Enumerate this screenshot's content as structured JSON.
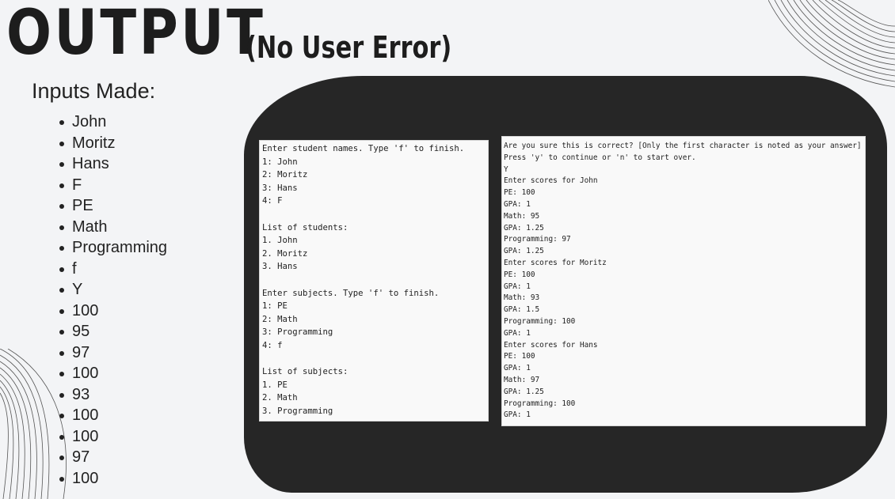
{
  "title": {
    "main": "OUTPUT",
    "sub": "(No User Error)"
  },
  "inputs": {
    "heading": "Inputs Made:",
    "items": [
      "John",
      "Moritz",
      "Hans",
      "F",
      "PE",
      "Math",
      "Programming",
      "f",
      "Y",
      "100",
      "95",
      "97",
      "100",
      "93",
      "100",
      "100",
      "97",
      "100"
    ]
  },
  "console_left": {
    "lines": [
      "Enter student names. Type 'f' to finish.",
      "1: John",
      "2: Moritz",
      "3: Hans",
      "4: F",
      "",
      "List of students:",
      "1. John",
      "2. Moritz",
      "3. Hans",
      "",
      "Enter subjects. Type 'f' to finish.",
      "1: PE",
      "2: Math",
      "3: Programming",
      "4: f",
      "",
      "List of subjects:",
      "1. PE",
      "2. Math",
      "3. Programming"
    ]
  },
  "console_right": {
    "lines": [
      "Are you sure this is correct? [Only the first character is noted as your answer]",
      "Press 'y' to continue or 'n' to start over.",
      "Y",
      "Enter scores for John",
      "PE: 100",
      "GPA: 1",
      "Math: 95",
      "GPA: 1.25",
      "Programming: 97",
      "GPA: 1.25",
      "Enter scores for Moritz",
      "PE: 100",
      "GPA: 1",
      "Math: 93",
      "GPA: 1.5",
      "Programming: 100",
      "GPA: 1",
      "Enter scores for Hans",
      "PE: 100",
      "GPA: 1",
      "Math: 97",
      "GPA: 1.25",
      "Programming: 100",
      "GPA: 1"
    ]
  }
}
